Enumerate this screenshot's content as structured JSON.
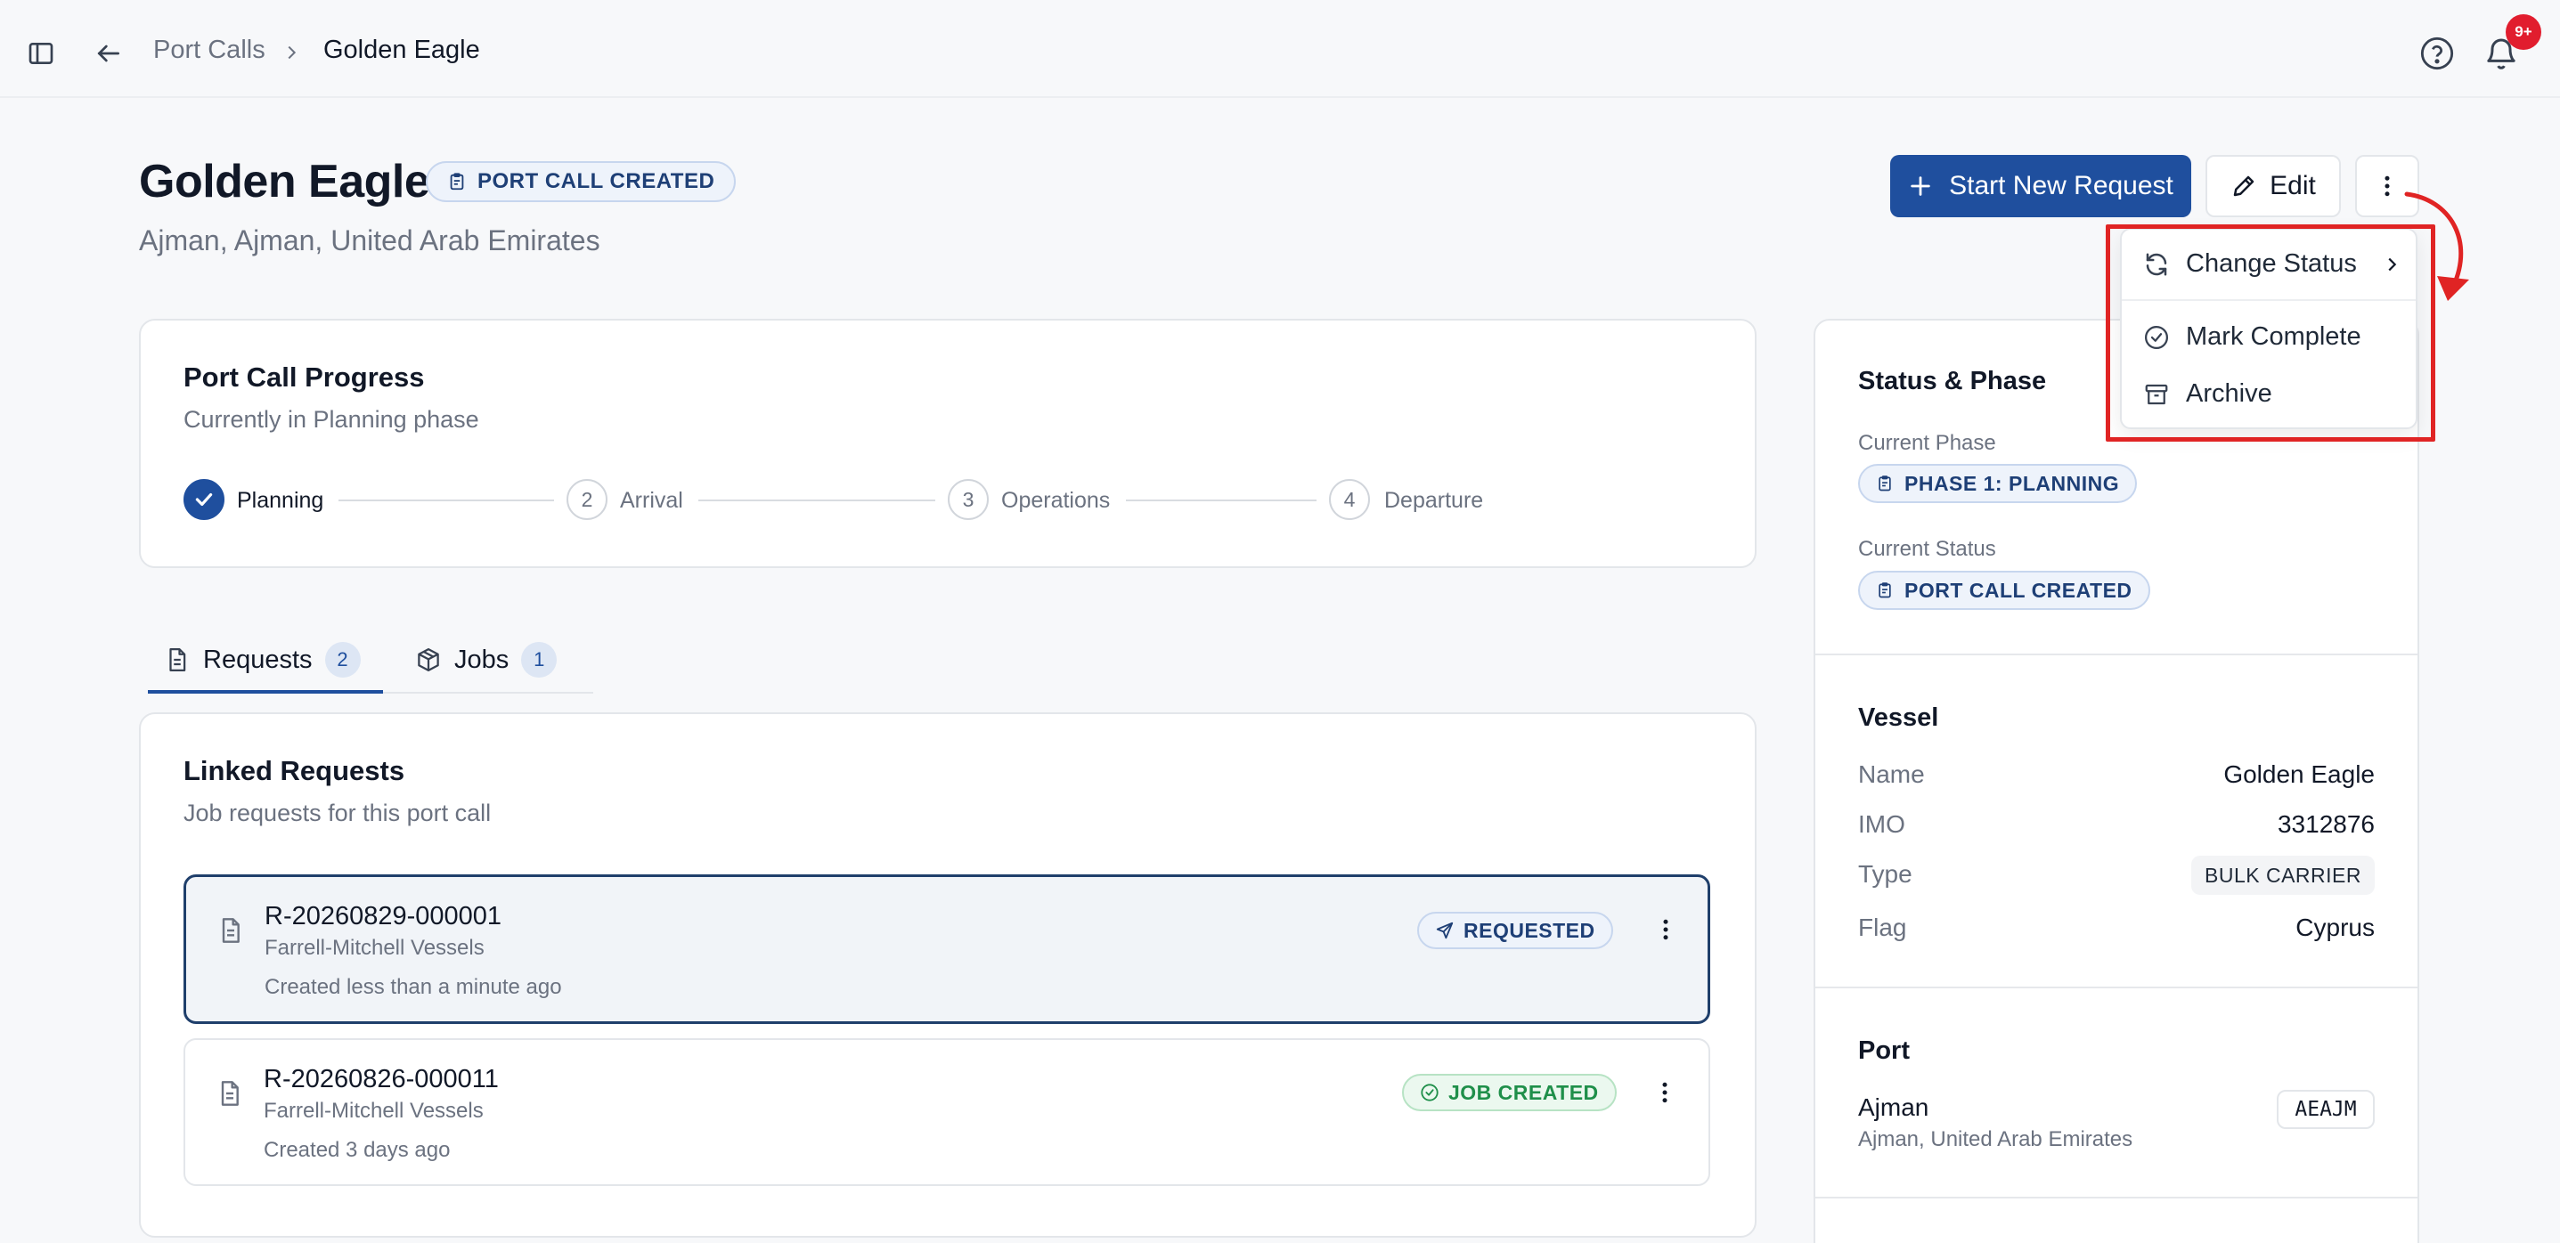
{
  "breadcrumb": {
    "parent": "Port Calls",
    "current": "Golden Eagle"
  },
  "notifications": {
    "badge": "9+"
  },
  "header": {
    "title": "Golden Eagle",
    "status_badge": "PORT CALL CREATED",
    "location": "Ajman, Ajman, United Arab Emirates",
    "start_request_label": "Start New Request",
    "edit_label": "Edit"
  },
  "menu": {
    "change_status": "Change Status",
    "mark_complete": "Mark Complete",
    "archive": "Archive"
  },
  "progress": {
    "title": "Port Call Progress",
    "subtitle": "Currently in Planning phase",
    "steps": [
      {
        "num": "",
        "label": "Planning",
        "done": true
      },
      {
        "num": "2",
        "label": "Arrival"
      },
      {
        "num": "3",
        "label": "Operations"
      },
      {
        "num": "4",
        "label": "Departure"
      }
    ]
  },
  "tabs": [
    {
      "label": "Requests",
      "count": "2"
    },
    {
      "label": "Jobs",
      "count": "1"
    }
  ],
  "linked_requests": {
    "title": "Linked Requests",
    "subtitle": "Job requests for this port call",
    "items": [
      {
        "id": "R-20260829-000001",
        "company": "Farrell-Mitchell Vessels",
        "created": "Created less than a minute ago",
        "status": "REQUESTED"
      },
      {
        "id": "R-20260826-000011",
        "company": "Farrell-Mitchell Vessels",
        "created": "Created 3 days ago",
        "status": "JOB CREATED"
      }
    ]
  },
  "status_phase": {
    "title": "Status & Phase",
    "current_phase_label": "Current Phase",
    "current_phase": "PHASE 1: PLANNING",
    "current_status_label": "Current Status",
    "current_status": "PORT CALL CREATED"
  },
  "vessel": {
    "title": "Vessel",
    "name_label": "Name",
    "name": "Golden Eagle",
    "imo_label": "IMO",
    "imo": "3312876",
    "type_label": "Type",
    "type": "BULK CARRIER",
    "flag_label": "Flag",
    "flag": "Cyprus"
  },
  "port": {
    "title": "Port",
    "name": "Ajman",
    "country": "Ajman, United Arab Emirates",
    "code": "AEAJM"
  },
  "colors": {
    "primary": "#1f4f9e",
    "accent_red": "#e02424",
    "success": "#1f8f4a"
  }
}
